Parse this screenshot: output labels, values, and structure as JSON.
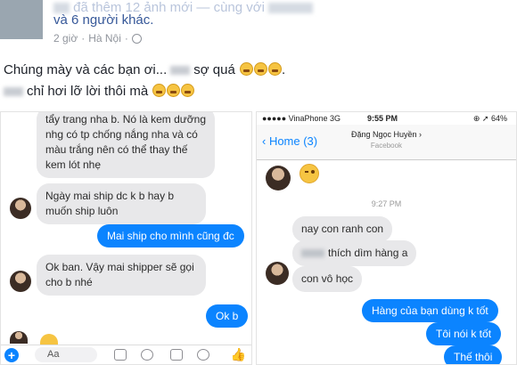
{
  "post": {
    "header_action": "đã thêm 12 ảnh mới — cùng với",
    "header_others": "và 6 người khác.",
    "time": "2 giờ",
    "location": "Hà Nội",
    "separator": "·",
    "caption_line1_start": "Chúng mày và các bạn ơi...",
    "caption_line1_end": "sợ quá",
    "caption_line2": "chỉ hơi lỡ lời thôi mà"
  },
  "left_chat": {
    "msg1": "tẩy trang nha b. Nó là kem dưỡng nhg có tp chống nắng nha và có màu trắng nên có thể thay thế kem lót nhẹ",
    "msg2": "Ngày mai ship dc k b hay b muốn ship luôn",
    "msg3": "Mai ship cho mình cũng đc",
    "msg4": "Ok ban. Vậy mai shipper sẽ gọi cho b nhé",
    "msg5": "Ok b",
    "composer_placeholder": "Aa",
    "plus": "+"
  },
  "right_chat": {
    "carrier": "●●●●● VinaPhone  3G",
    "clock": "9:55 PM",
    "battery": "⊕ ➚ 64%",
    "back_label": "‹ Home (3)",
    "contact_name": "Đặng Ngọc Huyền ›",
    "contact_sub": "Facebook",
    "timestamp": "9:27 PM",
    "msg1": "nay con ranh con",
    "msg2": "thích dìm hàng a",
    "msg3": "con vô học",
    "msg4": "Hàng của bạn dùng k tốt",
    "msg5": "Tôi nói k tốt",
    "msg6": "Thế thôi"
  },
  "icons": {
    "globe": "globe-icon",
    "emoji": "crying-face-icon",
    "wink": "winking-face-icon",
    "like": "thumbs-up-icon"
  },
  "colors": {
    "link": "#365899",
    "messenger_blue": "#0b84ff",
    "gray_bubble": "#e8e8ea"
  }
}
